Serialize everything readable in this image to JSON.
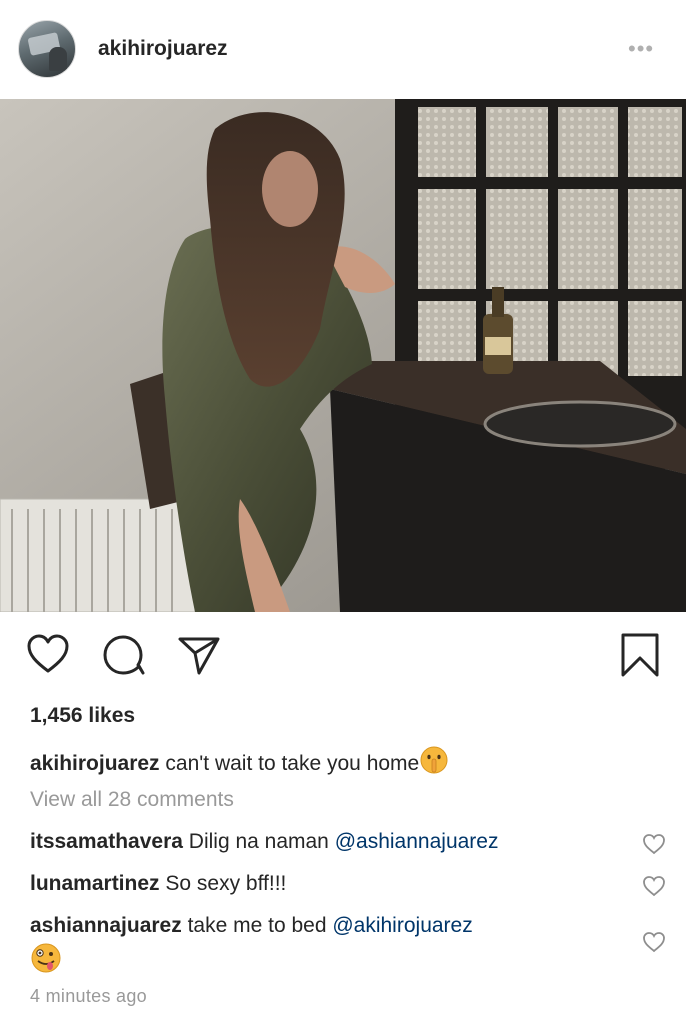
{
  "post": {
    "username": "akihirojuarez",
    "more_icon": "ellipsis-icon",
    "likes": "1,456 likes",
    "caption_user": "akihirojuarez",
    "caption_text": "can't wait to take you home",
    "caption_emoji": "shushing-face-emoji",
    "view_all": "View all 28 comments",
    "timestamp": "4 minutes ago"
  },
  "actions": {
    "like_icon": "heart-icon",
    "comment_icon": "comment-icon",
    "share_icon": "send-icon",
    "save_icon": "bookmark-icon"
  },
  "comments": [
    {
      "user": "itssamathavera",
      "text": "Dilig na naman",
      "mention": "@ashiannajuarez"
    },
    {
      "user": "lunamartinez",
      "text": "So sexy bff!!!",
      "mention": ""
    },
    {
      "user": "ashiannajuarez",
      "text": "take me to bed",
      "mention": "@akihirojuarez",
      "emoji": "zany-face-emoji"
    }
  ],
  "colors": {
    "text": "#262626",
    "secondary": "#999999",
    "mention": "#003569"
  }
}
